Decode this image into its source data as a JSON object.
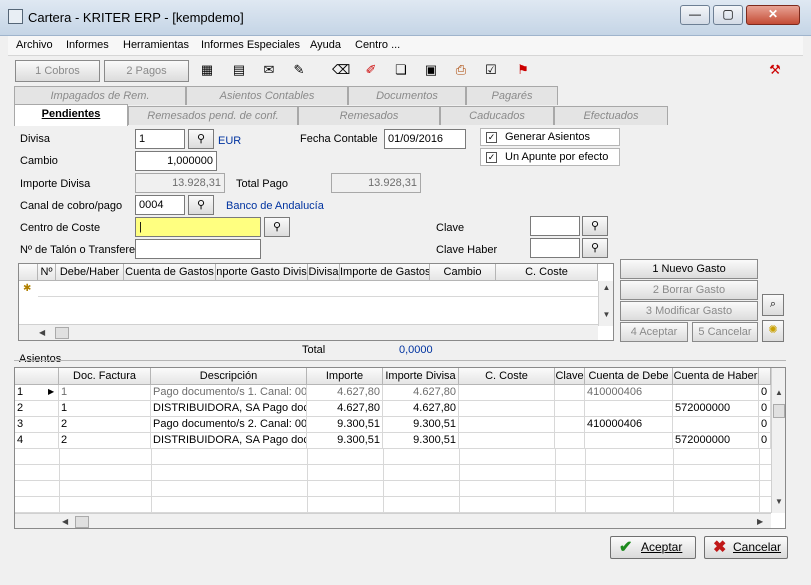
{
  "window": {
    "title": "Cartera - KRITER ERP - [kempdemo]"
  },
  "menu": [
    "Archivo",
    "Informes",
    "Herramientas",
    "Informes Especiales",
    "Ayuda",
    "Centro ..."
  ],
  "toolbar": {
    "cobros_label": "1 Cobros",
    "pagos_label": "2 Pagos"
  },
  "tabs_row1": [
    "Impagados de Rem.",
    "Asientos Contables",
    "Documentos",
    "Pagarés"
  ],
  "tabs_row2": [
    "Pendientes",
    "Remesados pend. de conf.",
    "Remesados",
    "Caducados",
    "Efectuados"
  ],
  "form": {
    "divisa_label": "Divisa",
    "divisa_value": "1",
    "divisa_name": "EUR",
    "fecha_label": "Fecha Contable",
    "fecha_value": "01/09/2016",
    "generar_asientos": "Generar Asientos",
    "un_apunte": "Un Apunte por efecto",
    "cambio_label": "Cambio",
    "cambio_value": "1,000000",
    "importe_divisa_label": "Importe Divisa",
    "importe_divisa_value": "13.928,31",
    "total_pago_label": "Total Pago",
    "total_pago_value": "13.928,31",
    "canal_label": "Canal de cobro/pago",
    "canal_value": "0004",
    "canal_name": "Banco de Andalucía",
    "centro_label": "Centro de Coste",
    "centro_value": "|",
    "clave_label": "Clave",
    "talon_label": "Nº de Talón o Transfere",
    "clave_haber_label": "Clave Haber"
  },
  "gastos": {
    "headers": [
      "Nº",
      "Debe/Haber",
      "Cuenta de Gastos",
      "nporte Gasto Divis",
      "Divisa",
      "Importe de Gastos",
      "Cambio",
      "C. Coste"
    ],
    "total_label": "Total",
    "total_value": "0,0000"
  },
  "side_buttons": {
    "nuevo": "1 Nuevo Gasto",
    "borrar": "2 Borrar Gasto",
    "modificar": "3 Modificar Gasto",
    "aceptar": "4 Aceptar",
    "cancelar": "5 Cancelar"
  },
  "asientos": {
    "label": "Asientos",
    "headers": [
      "Doc. Factura",
      "Descripción",
      "Importe",
      "Importe Divisa",
      "C. Coste",
      "Clave",
      "Cuenta de Debe",
      "Cuenta de Haber"
    ],
    "rows": [
      {
        "n": "1",
        "doc": "1",
        "desc": "Pago documento/s 1. Canal: 00",
        "imp": "4.627,80",
        "impd": "4.627,80",
        "debe": "410000406",
        "haber": "",
        "extra": "0"
      },
      {
        "n": "2",
        "doc": "1",
        "desc": "DISTRIBUIDORA, SA Pago doc",
        "imp": "4.627,80",
        "impd": "4.627,80",
        "debe": "",
        "haber": "572000000",
        "extra": "0"
      },
      {
        "n": "3",
        "doc": "2",
        "desc": "Pago documento/s 2. Canal: 00",
        "imp": "9.300,51",
        "impd": "9.300,51",
        "debe": "410000406",
        "haber": "",
        "extra": "0"
      },
      {
        "n": "4",
        "doc": "2",
        "desc": "DISTRIBUIDORA, SA Pago doc",
        "imp": "9.300,51",
        "impd": "9.300,51",
        "debe": "",
        "haber": "572000000",
        "extra": "0"
      }
    ]
  },
  "footer": {
    "aceptar": "Aceptar",
    "cancelar": "Cancelar"
  },
  "colors": {
    "accent_blue": "#0033a0",
    "highlight_yellow": "#ffff80"
  }
}
